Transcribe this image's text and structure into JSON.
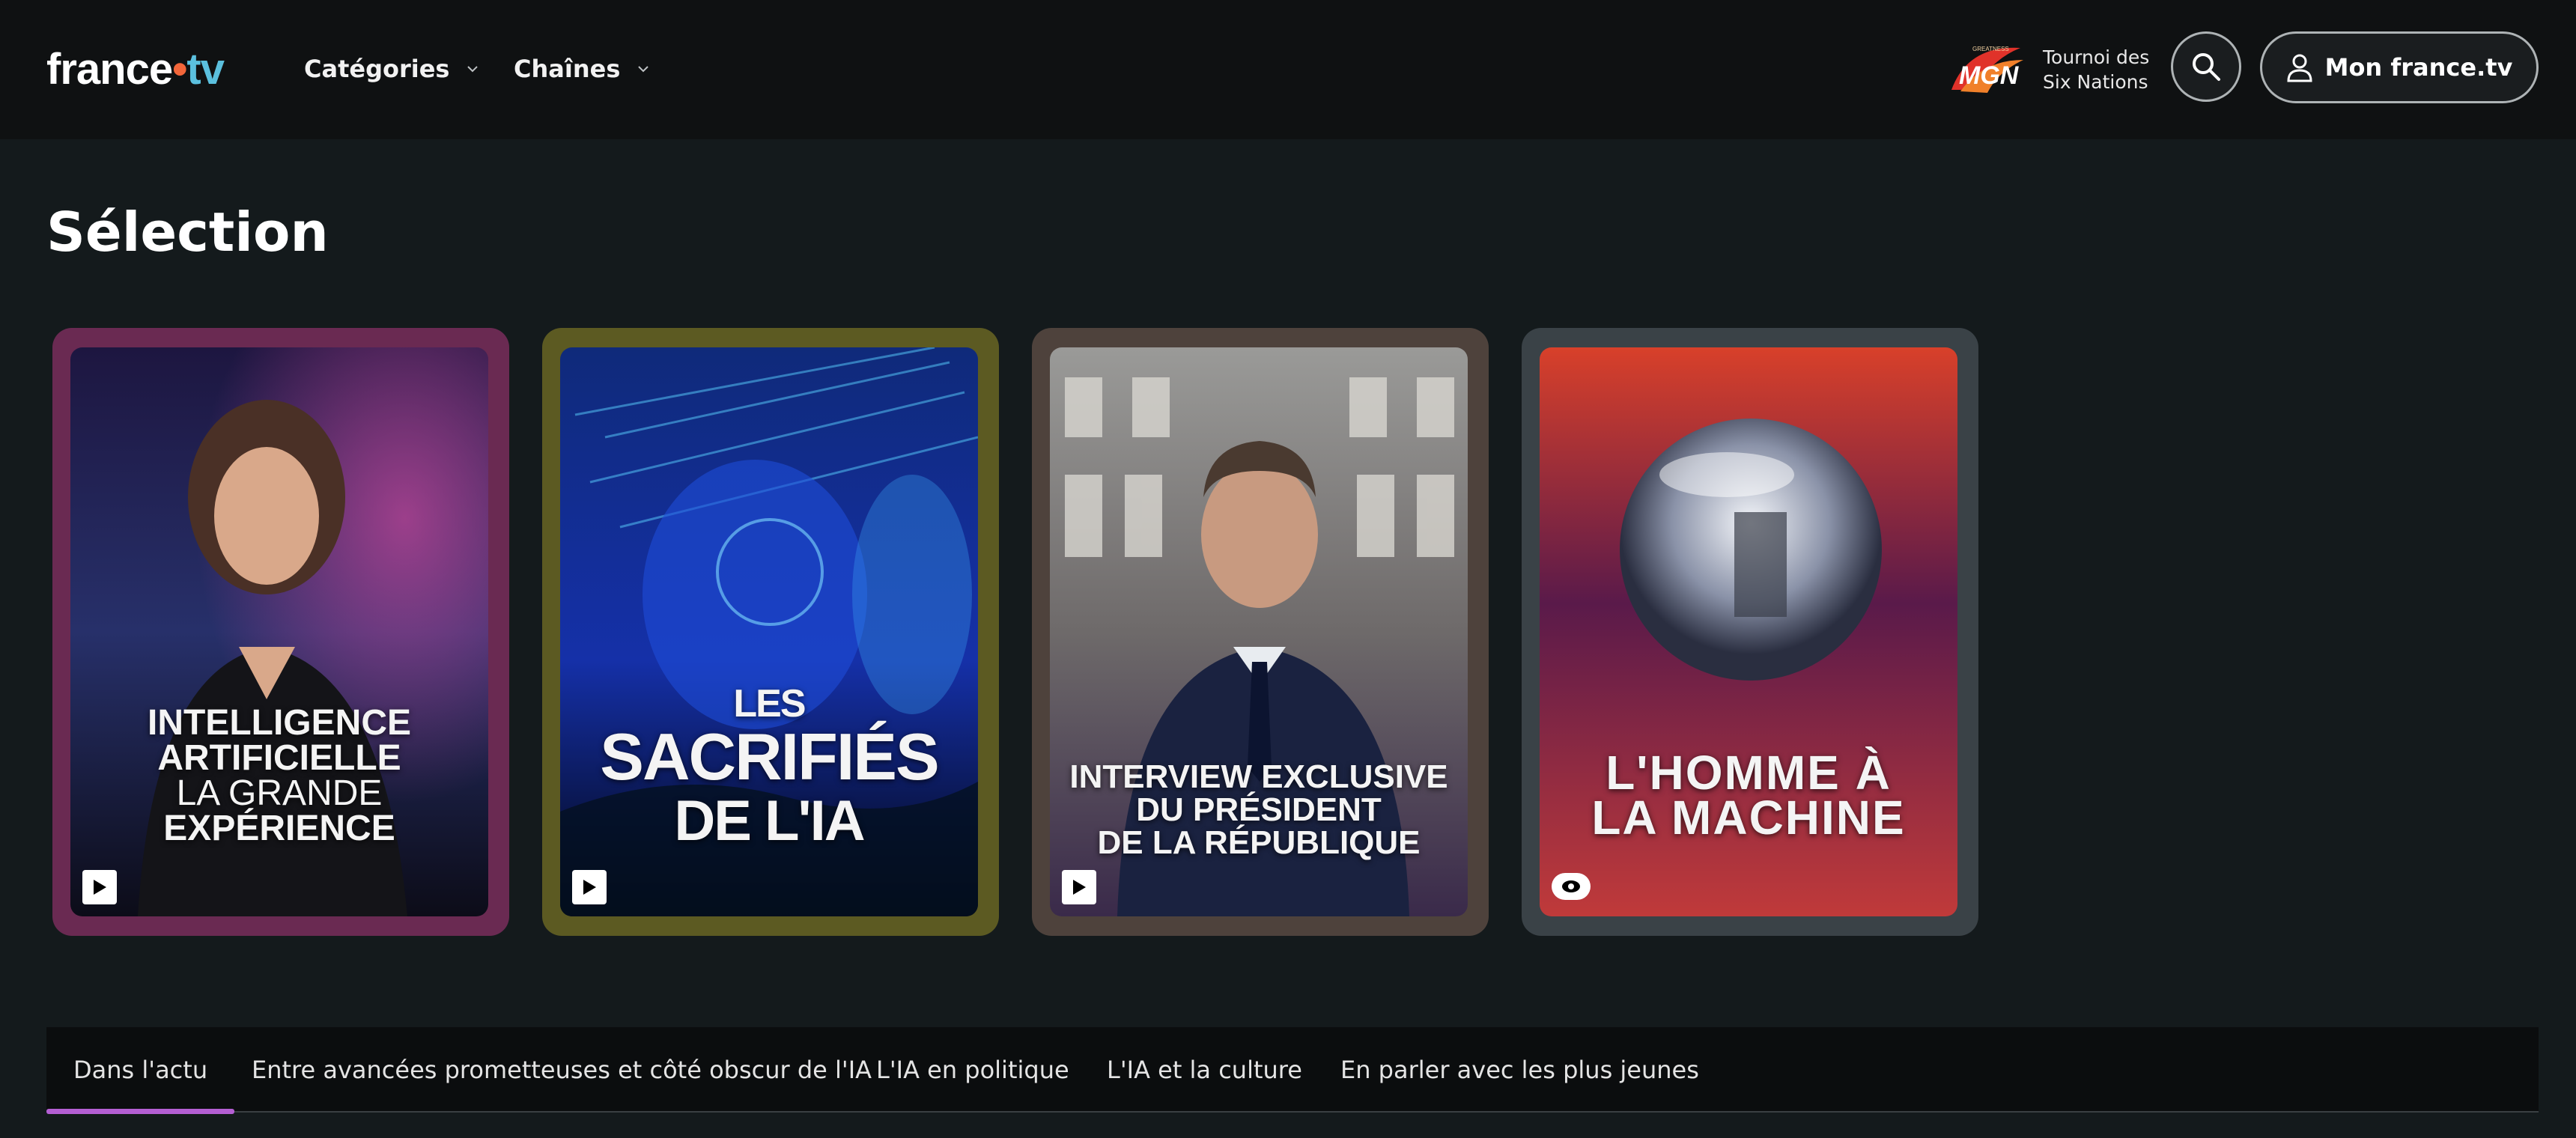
{
  "header": {
    "logo_text": "france",
    "logo_dot": "•",
    "logo_suffix": "tv",
    "nav": [
      {
        "label": "Catégories"
      },
      {
        "label": "Chaînes"
      }
    ],
    "promo": {
      "logo_text": "MGN",
      "logo_subtext": "GREATNESS",
      "line1": "Tournoi des",
      "line2": "Six Nations"
    },
    "account_label": "Mon france.tv"
  },
  "section_title": "Sélection",
  "cards": [
    {
      "title_lines": [
        "INTELLIGENCE",
        "ARTIFICIELLE",
        "LA GRANDE",
        "EXPÉRIENCE"
      ],
      "badge": "play",
      "frame_color": "#6a2a52"
    },
    {
      "title_lines": [
        "LES",
        "SACRIFIÉS",
        "DE L'IA"
      ],
      "badge": "play",
      "frame_color": "#5c5a22"
    },
    {
      "title_lines": [
        "INTERVIEW EXCLUSIVE",
        "DU PRÉSIDENT",
        "DE LA RÉPUBLIQUE"
      ],
      "badge": "play",
      "frame_color": "#4e423c"
    },
    {
      "title_lines": [
        "L'HOMME À",
        "LA MACHINE"
      ],
      "badge": "live",
      "frame_color": "#3a4247"
    }
  ],
  "tabs": [
    {
      "label": "Dans l'actu",
      "active": true
    },
    {
      "label": "Entre avancées prometteuses et côté obscur de l'IA",
      "active": false
    },
    {
      "label": "L'IA en politique",
      "active": false
    },
    {
      "label": "L'IA et la culture",
      "active": false
    },
    {
      "label": "En parler avec les plus jeunes",
      "active": false
    }
  ],
  "colors": {
    "header_bg": "#0f1112",
    "page_bg": "#141a1c",
    "tab_active_underline": "#b45fd3",
    "logo_dot": "#f2663a",
    "logo_tv": "#5bc0de"
  },
  "icons": [
    "chevron-down-icon",
    "search-icon",
    "user-icon",
    "play-icon",
    "live-icon"
  ]
}
